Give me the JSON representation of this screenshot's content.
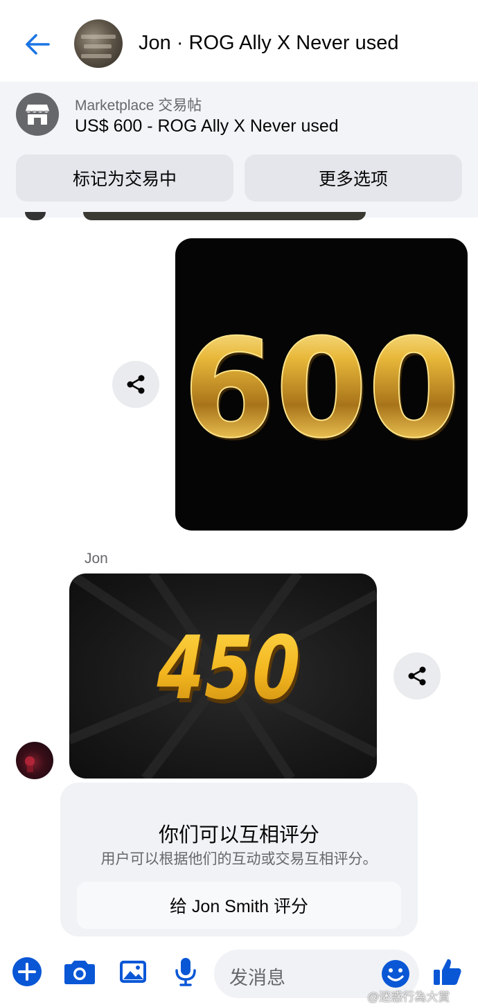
{
  "header": {
    "title": "Jon · ROG Ally X Never used"
  },
  "listing": {
    "subtitle": "Marketplace 交易帖",
    "price_title": "US$ 600 - ROG Ally X Never used",
    "mark_button": "标记为交易中",
    "more_button": "更多选项"
  },
  "messages": [
    {
      "sender": "",
      "image_text": "600"
    },
    {
      "sender": "Jon",
      "image_text": "450"
    }
  ],
  "rating": {
    "title": "你们可以互相评分",
    "subtitle": "用户可以根据他们的互动或交易互相评分。",
    "button": "给 Jon Smith 评分"
  },
  "composer": {
    "placeholder": "发消息"
  },
  "watermark": "@迷惑行為大賞",
  "colors": {
    "accent": "#0a57d6",
    "back_arrow": "#1b74e4",
    "gold": "#e0a826"
  },
  "icons": [
    "back-arrow-icon",
    "store-icon",
    "share-icon",
    "plus-icon",
    "camera-icon",
    "gallery-icon",
    "microphone-icon",
    "emoji-icon",
    "thumbs-up-icon"
  ]
}
